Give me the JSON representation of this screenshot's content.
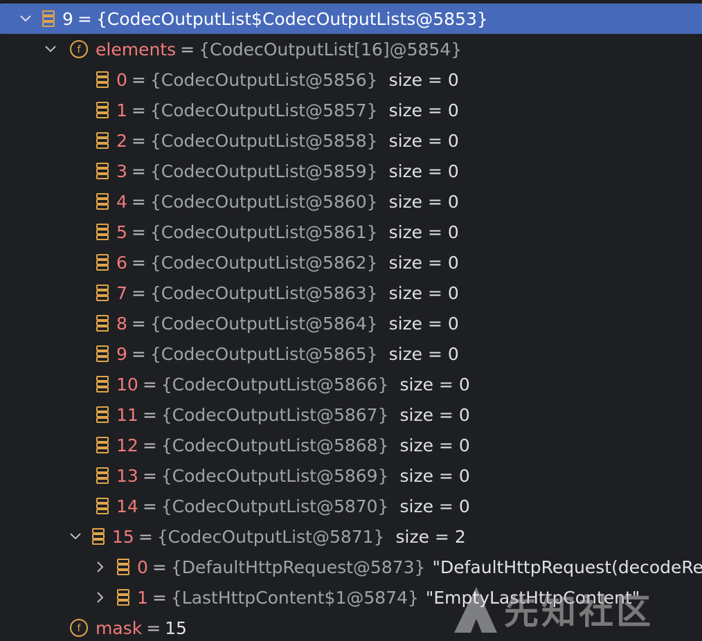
{
  "root": {
    "index": "9",
    "ref": "{CodecOutputList$CodecOutputLists@5853}"
  },
  "elements_field": {
    "name": "elements",
    "ref": "{CodecOutputList[16]@5854}"
  },
  "items": [
    {
      "index": "0",
      "ref": "{CodecOutputList@5856}",
      "size": "size = 0"
    },
    {
      "index": "1",
      "ref": "{CodecOutputList@5857}",
      "size": "size = 0"
    },
    {
      "index": "2",
      "ref": "{CodecOutputList@5858}",
      "size": "size = 0"
    },
    {
      "index": "3",
      "ref": "{CodecOutputList@5859}",
      "size": "size = 0"
    },
    {
      "index": "4",
      "ref": "{CodecOutputList@5860}",
      "size": "size = 0"
    },
    {
      "index": "5",
      "ref": "{CodecOutputList@5861}",
      "size": "size = 0"
    },
    {
      "index": "6",
      "ref": "{CodecOutputList@5862}",
      "size": "size = 0"
    },
    {
      "index": "7",
      "ref": "{CodecOutputList@5863}",
      "size": "size = 0"
    },
    {
      "index": "8",
      "ref": "{CodecOutputList@5864}",
      "size": "size = 0"
    },
    {
      "index": "9",
      "ref": "{CodecOutputList@5865}",
      "size": "size = 0"
    },
    {
      "index": "10",
      "ref": "{CodecOutputList@5866}",
      "size": "size = 0"
    },
    {
      "index": "11",
      "ref": "{CodecOutputList@5867}",
      "size": "size = 0"
    },
    {
      "index": "12",
      "ref": "{CodecOutputList@5868}",
      "size": "size = 0"
    },
    {
      "index": "13",
      "ref": "{CodecOutputList@5869}",
      "size": "size = 0"
    },
    {
      "index": "14",
      "ref": "{CodecOutputList@5870}",
      "size": "size = 0"
    },
    {
      "index": "15",
      "ref": "{CodecOutputList@5871}",
      "size": "size = 2"
    }
  ],
  "sub_items": [
    {
      "index": "0",
      "ref": "{DefaultHttpRequest@5873}",
      "value": "\"DefaultHttpRequest(decodeRes"
    },
    {
      "index": "1",
      "ref": "{LastHttpContent$1@5874}",
      "value": "\"EmptyLastHttpContent\""
    }
  ],
  "mask_field": {
    "name": "mask",
    "value": "15"
  },
  "equals": "=",
  "watermark": {
    "text": "先知社区"
  },
  "colors": {
    "background": "#1e1f22",
    "selection": "#4669b9",
    "name": "#f07b7b",
    "ref": "#a0a3a8",
    "icon": "#e0a64b"
  }
}
